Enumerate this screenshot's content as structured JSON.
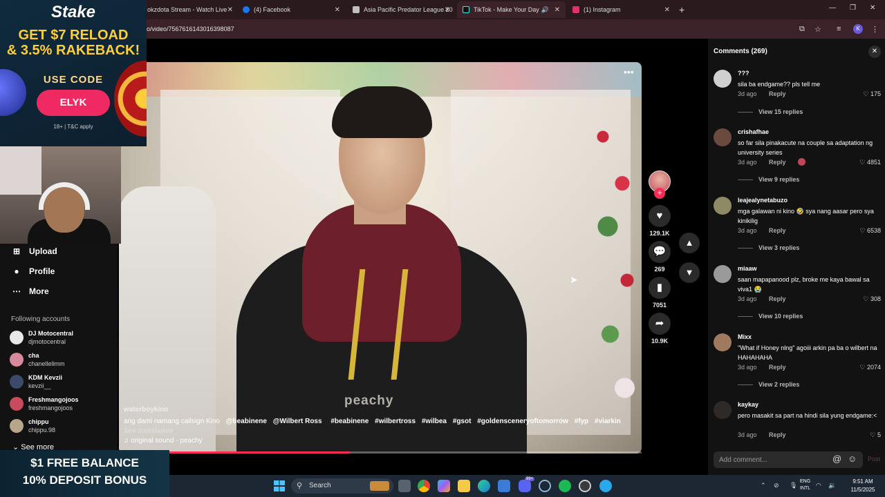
{
  "browser": {
    "tabs": [
      {
        "title": "okzdota Stream - Watch Live",
        "icon_color": "#2a1a1e"
      },
      {
        "title": "(4) Facebook",
        "icon_color": "#1877f2"
      },
      {
        "title": "Asia Pacific Predator League 20",
        "icon_color": "#c0c0c0"
      },
      {
        "title": "TikTok - Make Your Day",
        "icon_color": "#000000"
      },
      {
        "title": "(1) Instagram",
        "icon_color": "#e1306c"
      }
    ],
    "url": "o/video/7567616143016398087",
    "profile_initial": "K"
  },
  "ads": {
    "top": {
      "brand": "Stake",
      "headline_line1": "GET $7 RELOAD",
      "headline_line2": "& 3.5% RAKEBACK!",
      "use_code": "USE CODE",
      "code": "ELYK",
      "legal": "18+ | T&C apply"
    },
    "bottom": {
      "line1": "$1 FREE BALANCE",
      "line2": "10% DEPOSIT BONUS"
    }
  },
  "sidebar": {
    "items": [
      {
        "label": "Upload",
        "icon": "upload-icon"
      },
      {
        "label": "Profile",
        "icon": "profile-icon"
      },
      {
        "label": "More",
        "icon": "more-icon"
      }
    ],
    "following_header": "Following accounts",
    "accounts": [
      {
        "name": "DJ Motocentral",
        "username": "djmotocentral",
        "color": "#e8e8e8"
      },
      {
        "name": "cha",
        "username": "chanellelimm",
        "color": "#d88a9a"
      },
      {
        "name": "KDM Kevzii",
        "username": "kevzii__",
        "color": "#3a4a6a"
      },
      {
        "name": "Freshmangojoos",
        "username": "freshmangojoos",
        "color": "#c94a5a"
      },
      {
        "name": "chippu",
        "username": "chippu.98",
        "color": "#b8a58a"
      }
    ],
    "see_more": "See more"
  },
  "video": {
    "watermark": "peachy",
    "author": "waterboykino",
    "caption_text": "ang dami namang callsign Kino",
    "mentions": [
      "@beabinene",
      "@Wilbert Ross"
    ],
    "hashtags": [
      "#beabinene",
      "#wilbertross",
      "#wilbea",
      "#gsot",
      "#goldensceneryoftomorrow",
      "#fyp",
      "#viarkin"
    ],
    "see_translation": "See translation",
    "sound": "original sound - peachy",
    "progress": 0.44
  },
  "actions": {
    "likes": "129.1K",
    "comments": "269",
    "saves": "7051",
    "shares": "10.9K"
  },
  "comments": {
    "title": "Comments (269)",
    "reply_label": "Reply",
    "items": [
      {
        "user": "???",
        "text": "sila ba endgame?? pls tell me",
        "age": "3d ago",
        "likes": "175",
        "view_replies": "View 15 replies",
        "avatar_color": "#d0d0d0",
        "lines": 1
      },
      {
        "user": "crishafhae",
        "text": "so far sila pinakacute na couple sa adaptation ng university series",
        "age": "3d ago",
        "likes": "4851",
        "view_replies": "View 9 replies",
        "avatar_color": "#6b4a3e",
        "lines": 2
      },
      {
        "user": "leajealynetabuzo",
        "text": "mga galawan ni kino 🤣 sya nang aasar pero sya kinikilig",
        "age": "3d ago",
        "likes": "6538",
        "view_replies": "View 3 replies",
        "avatar_color": "#8f8a66",
        "lines": 2
      },
      {
        "user": "miaaw",
        "text": "saan mapapanood plz, broke me kaya bawal sa viva1 😭",
        "age": "3d ago",
        "likes": "308",
        "view_replies": "View 10 replies",
        "avatar_color": "#9a9a9a",
        "lines": 2
      },
      {
        "user": "Mixx",
        "text": "\"What if Honey nlng\" agoiii arkin pa ba o wilbert na HAHAHAHA",
        "age": "3d ago",
        "likes": "2074",
        "view_replies": "View 2 replies",
        "avatar_color": "#a07a5e",
        "lines": 2
      },
      {
        "user": "kaykay",
        "text": "pero masakit sa part na hindi sila yung endgame:<",
        "age": "3d ago",
        "likes": "5",
        "view_replies": "",
        "avatar_color": "#2e2a28",
        "lines": 2
      }
    ],
    "add_placeholder": "Add comment...",
    "post_label": "Post"
  },
  "taskbar": {
    "search_label": "Search",
    "lang_top": "ENG",
    "lang_bottom": "INTL",
    "time": "9:51 AM",
    "date": "11/5/2025",
    "badge": "99+"
  }
}
